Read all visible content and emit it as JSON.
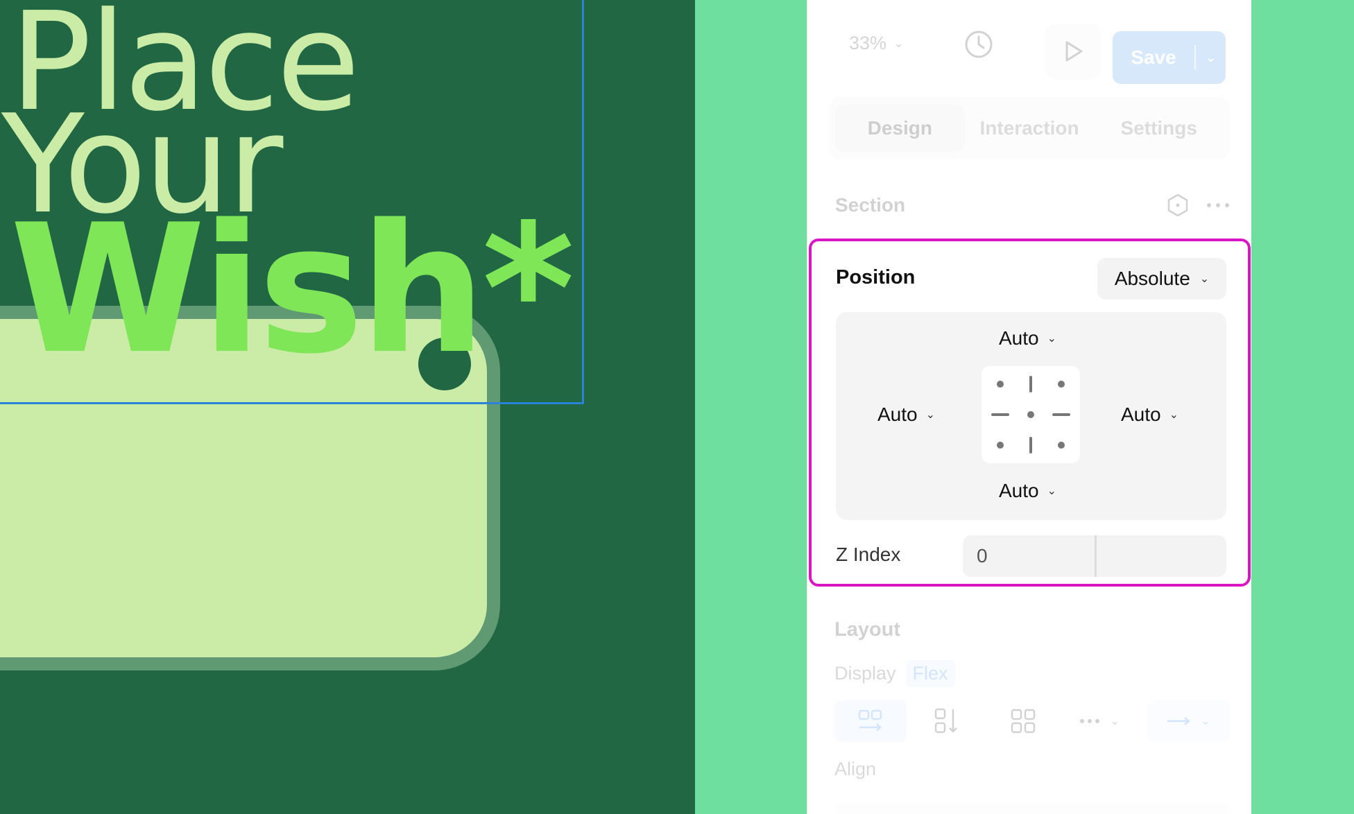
{
  "canvas": {
    "headline": {
      "line1": "Place",
      "line2": "Your",
      "line3": "Wish*"
    }
  },
  "toolbar": {
    "zoom": "33%",
    "save_label": "Save"
  },
  "tabs": [
    {
      "label": "Design",
      "active": true
    },
    {
      "label": "Interaction",
      "active": false
    },
    {
      "label": "Settings",
      "active": false
    }
  ],
  "section": {
    "title": "Section"
  },
  "position": {
    "title": "Position",
    "mode": "Absolute",
    "top": "Auto",
    "left": "Auto",
    "right": "Auto",
    "bottom": "Auto",
    "z_index_label": "Z Index",
    "z_index_value": "0"
  },
  "layout": {
    "title": "Layout",
    "display_label": "Display",
    "display_value": "Flex",
    "align_label": "Align"
  },
  "colors": {
    "canvas_bg": "#216744",
    "app_bg": "#6fdf9f",
    "highlight": "#d915c6",
    "accent": "#3b8fef",
    "selection": "#2a83d9"
  }
}
